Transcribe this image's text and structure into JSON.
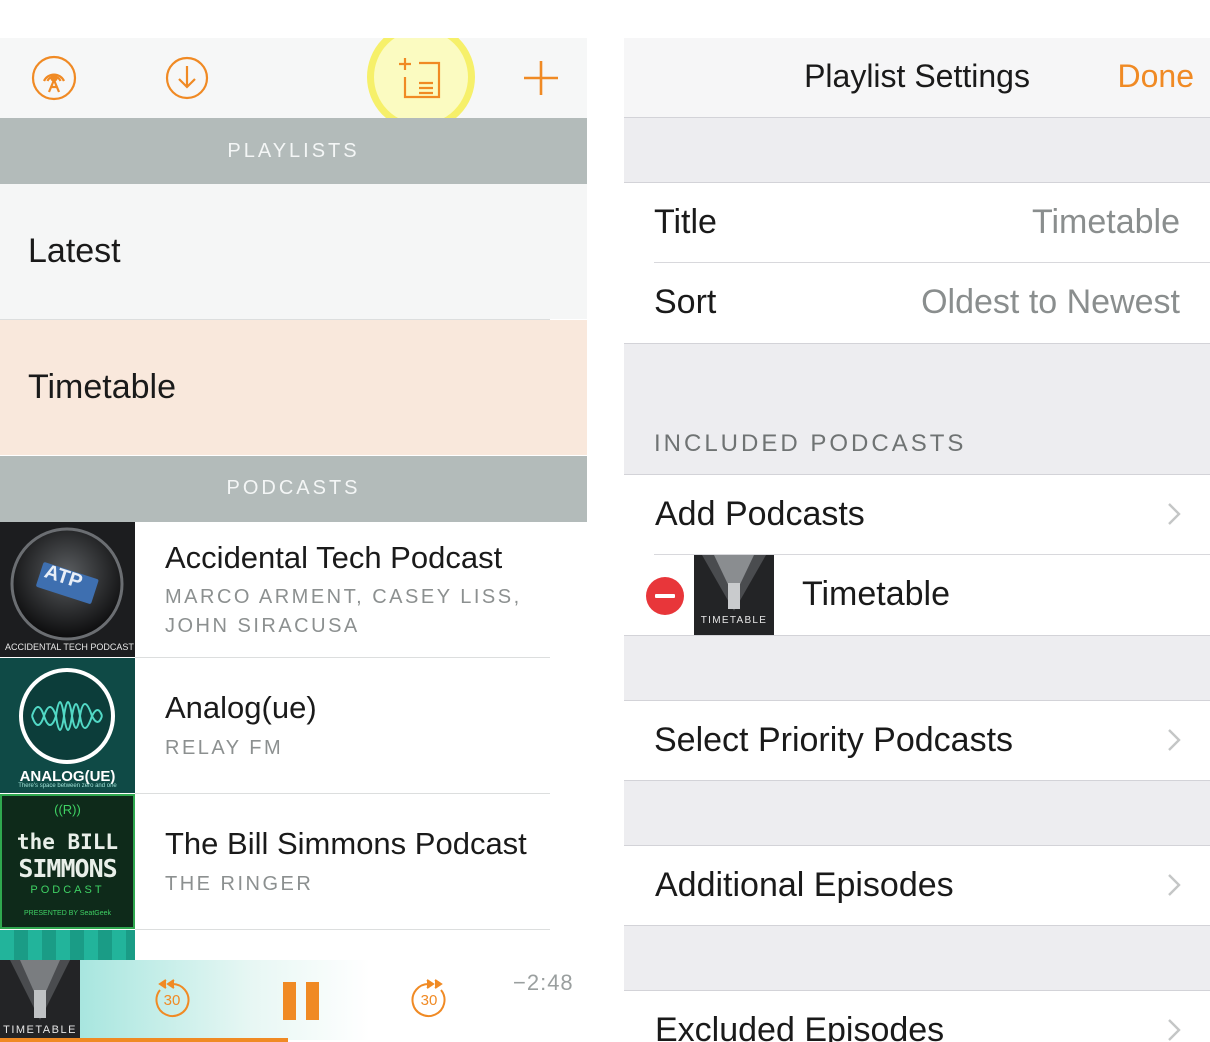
{
  "left": {
    "toolbar": {
      "icons": [
        "broadcast-icon",
        "download-icon",
        "new-playlist-icon",
        "plus-icon"
      ]
    },
    "playlists_header": "PLAYLISTS",
    "playlists": [
      {
        "label": "Latest"
      },
      {
        "label": "Timetable"
      }
    ],
    "podcasts_header": "PODCASTS",
    "podcasts": [
      {
        "title": "Accidental Tech Podcast",
        "author_line1": "MARCO ARMENT, CASEY LISS,",
        "author_line2": "JOHN SIRACUSA",
        "art_text": "ATP",
        "art_caption": "ACCIDENTAL TECH PODCAST"
      },
      {
        "title": "Analog(ue)",
        "author_line1": "RELAY FM",
        "art_text": "ANALOG(UE)",
        "art_caption": "There's space between zero and one"
      },
      {
        "title": "The Bill Simmons Podcast",
        "author_line1": "THE RINGER",
        "art_text_top": "the BILL",
        "art_text_mid": "SIMMONS",
        "art_text_bot": "PODCAST",
        "art_caption": "PRESENTED BY SeatGeek"
      }
    ],
    "player": {
      "art_label": "TIMETABLE",
      "skip_back": "30",
      "skip_forward": "30",
      "time_remaining": "−2:48",
      "progress": 0.49
    }
  },
  "right": {
    "nav": {
      "title": "Playlist Settings",
      "done": "Done"
    },
    "settings": {
      "title_label": "Title",
      "title_value": "Timetable",
      "sort_label": "Sort",
      "sort_value": "Oldest to Newest"
    },
    "included_header": "INCLUDED PODCASTS",
    "add_podcasts": "Add Podcasts",
    "included": [
      {
        "name": "Timetable",
        "art_label": "TIMETABLE"
      }
    ],
    "select_priority": "Select Priority Podcasts",
    "additional_episodes": "Additional Episodes",
    "excluded_episodes": "Excluded Episodes"
  },
  "colors": {
    "accent": "#f08a24",
    "section_header_bg": "#b3bbba",
    "selected_row_bg": "#f9e8dc",
    "delete_red": "#e8363a"
  }
}
